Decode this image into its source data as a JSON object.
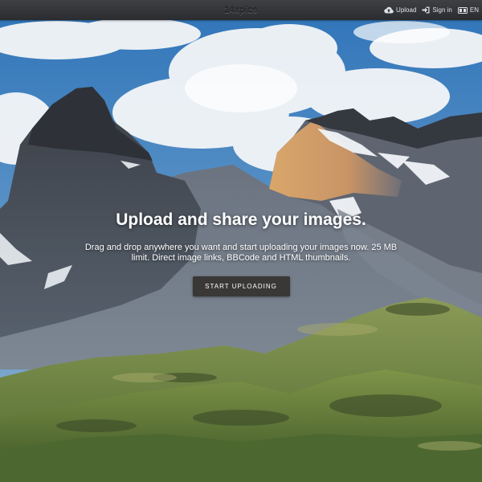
{
  "header": {
    "logo_text": "14xpics",
    "nav": {
      "upload_label": "Upload",
      "signin_label": "Sign in",
      "language_label": "EN"
    }
  },
  "hero": {
    "headline": "Upload and share your images.",
    "subtext": "Drag and drop anywhere you want and start uploading your images now. 25 MB limit. Direct image links, BBCode and HTML thumbnails.",
    "cta_label": "START UPLOADING"
  },
  "colors": {
    "topbar": "#2f3033",
    "cta_background": "#3a3737",
    "sky": "#4b86c2"
  },
  "icons": [
    "cloud-upload-icon",
    "sign-in-icon",
    "language-flag-icon"
  ]
}
